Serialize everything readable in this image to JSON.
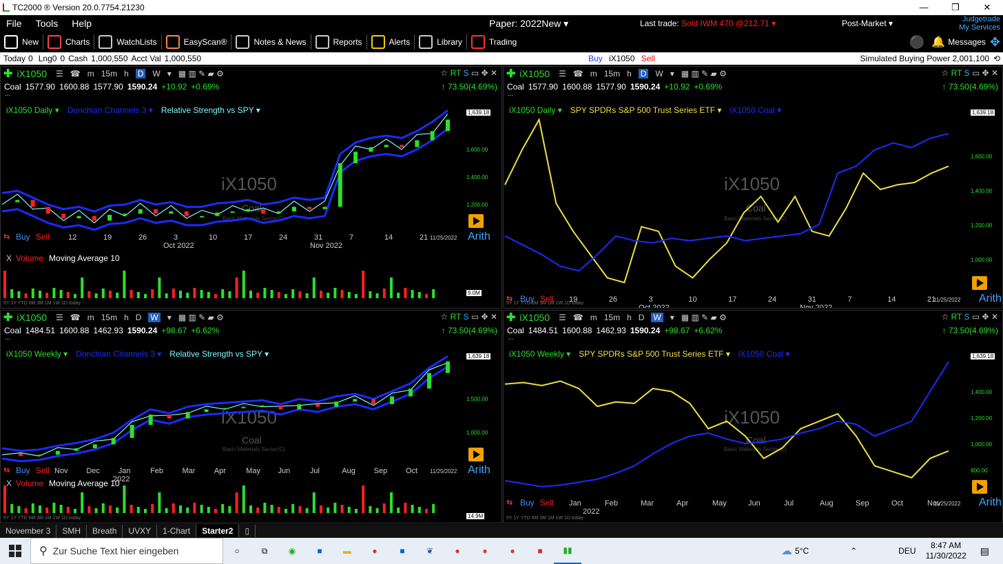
{
  "window": {
    "title": "TC2000 ® Version 20.0.7754.21230",
    "min": "—",
    "max": "❒",
    "close": "✕"
  },
  "menu": {
    "file": "File",
    "tools": "Tools",
    "help": "Help"
  },
  "header": {
    "paper": "Paper: 2022New ▾",
    "last_trade_label": "Last trade:",
    "last_trade_value": "Sold IWM 470 @212.71 ▾",
    "post_market": "Post-Market ▾",
    "judge1": "Judgetrade",
    "judge2": "My Services"
  },
  "toolbar": {
    "new": "New",
    "charts": "Charts",
    "watchlists": "WatchLists",
    "easyscan": "EasyScan®",
    "notes": "Notes & News",
    "reports": "Reports",
    "alerts": "Alerts",
    "library": "Library",
    "trading": "Trading",
    "messages": "Messages"
  },
  "account": {
    "today": "Today",
    "today_v": "0",
    "lng": "Lng",
    "lng_v": "0",
    "lng_v2": "0",
    "cash": "Cash",
    "cash_v": "1,000,550",
    "acct": "Acct Val",
    "acct_v": "1,000,550",
    "buy": "Buy",
    "sym": "iX1050",
    "sell": "Sell",
    "sbp": "Simulated Buying Power",
    "sbp_v": "2,001,100"
  },
  "panes": [
    {
      "symbol": "iX1050",
      "timeframes": [
        "m",
        "15m",
        "h",
        "D",
        "W"
      ],
      "quote": {
        "name": "Coal",
        "open": "1577.90",
        "high": "1600.88",
        "low": "1577.90",
        "last": "1590.24",
        "change": "+10.92",
        "pct": "+0.69%"
      },
      "right_change": "↑ 73.50(4.69%)",
      "legend": [
        "iX1050 Daily ▾",
        "Donchian Channels 3 ▾",
        "Relative Strength vs SPY ▾"
      ],
      "watermark": "iX1050",
      "wm_sub": "Coal",
      "wm_sector": "Basic Materials Sector(C)",
      "buy": "Buy",
      "sell": "Sell",
      "arith": "Arith",
      "date": "11/25/2022",
      "xticks": [
        "12",
        "19",
        "26",
        "3",
        "10",
        "17",
        "24",
        "31",
        "7",
        "14",
        "21"
      ],
      "months": [
        "Oct 2022",
        "Nov 2022"
      ],
      "yticks": [
        "1,639.18",
        "1,600.00",
        "1,400.00",
        "1,200.00"
      ],
      "volume": {
        "x": "X",
        "label": "Volume",
        "ma": "Moving Average 10",
        "box": "9.0M"
      },
      "scale": "5Y  1Y  YTD  6M  3M  1M  1W  1D  today"
    },
    {
      "symbol": "iX1050",
      "timeframes": [
        "m",
        "15m",
        "h",
        "D",
        "W"
      ],
      "quote": {
        "name": "Coal",
        "open": "1577.90",
        "high": "1600.88",
        "low": "1577.90",
        "last": "1590.24",
        "change": "+10.92",
        "pct": "+0.69%"
      },
      "right_change": "↑ 73.50(4.69%)",
      "legend": [
        "iX1050 Daily ▾",
        "SPY SPDRs S&P 500 Trust Series ETF ▾",
        "iX1050 Coal ▾"
      ],
      "watermark": "iX1050",
      "wm_sub": "Coal",
      "wm_sector": "Basic Materials Sector(C)",
      "buy": "Buy",
      "sell": "Sell",
      "arith": "Arith",
      "date": "11/25/2022",
      "xticks": [
        "19",
        "26",
        "3",
        "10",
        "17",
        "24",
        "31",
        "7",
        "14",
        "21"
      ],
      "months": [
        "Oct 2022",
        "Nov 2022"
      ],
      "yticks": [
        "1,639.18",
        "1,600.00",
        "1,400.00",
        "1,200.00",
        "1,000.00"
      ],
      "scale": "5Y  1Y  YTD  6M  3M  1M  1W  1D  today"
    },
    {
      "symbol": "iX1050",
      "timeframes": [
        "m",
        "15m",
        "h",
        "D",
        "W"
      ],
      "quote": {
        "name": "Coal",
        "open": "1484.51",
        "high": "1600.88",
        "low": "1462.93",
        "last": "1590.24",
        "change": "+98.67",
        "pct": "+6.62%"
      },
      "right_change": "↑ 73.50(4.69%)",
      "legend": [
        "iX1050 Weekly ▾",
        "Donchian Channels 3 ▾",
        "Relative Strength vs SPY ▾"
      ],
      "watermark": "iX1050",
      "wm_sub": "Coal",
      "wm_sector": "Basic Materials Sector(C)",
      "buy": "Buy",
      "sell": "Sell",
      "arith": "Arith",
      "date": "11/25/2022",
      "xticks": [
        "Nov",
        "Dec",
        "Jan",
        "Feb",
        "Mar",
        "Apr",
        "May",
        "Jun",
        "Jul",
        "Aug",
        "Sep",
        "Oct"
      ],
      "months": [
        "2022"
      ],
      "yticks": [
        "1,639.18",
        "1,500.00",
        "1,000.00"
      ],
      "volume": {
        "x": "X",
        "label": "Volume",
        "ma": "Moving Average 10",
        "box": "14.9M"
      },
      "scale": "5Y  1Y  YTD  6M  3M  1M  1W  1D  today"
    },
    {
      "symbol": "iX1050",
      "timeframes": [
        "m",
        "15m",
        "h",
        "D",
        "W"
      ],
      "quote": {
        "name": "Coal",
        "open": "1484.51",
        "high": "1600.88",
        "low": "1462.93",
        "last": "1590.24",
        "change": "+98.67",
        "pct": "+6.62%"
      },
      "right_change": "↑ 73.50(4.69%)",
      "legend": [
        "iX1050 Weekly ▾",
        "SPY SPDRs S&P 500 Trust Series ETF ▾",
        "iX1050 Coal ▾"
      ],
      "watermark": "iX1050",
      "wm_sub": "Coal",
      "wm_sector": "Basic Materials Sector(C)",
      "buy": "Buy",
      "sell": "Sell",
      "arith": "Arith",
      "date": "11/25/2022",
      "xticks": [
        "Jan",
        "Feb",
        "Mar",
        "Apr",
        "May",
        "Jun",
        "Jul",
        "Aug",
        "Sep",
        "Oct",
        "Nov"
      ],
      "months": [
        "2022"
      ],
      "yticks": [
        "1,639.18",
        "1,400.00",
        "1,200.00",
        "1,000.00",
        "800.00"
      ],
      "scale": "5Y  1Y  YTD  6M  3M  1M  1W  1D  today"
    }
  ],
  "tabs": [
    "November 3",
    "SMH",
    "Breath",
    "UVXY",
    "1-Chart",
    "Starter2"
  ],
  "taskbar": {
    "search": "Zur Suche Text hier eingeben",
    "weather": "5°C",
    "lang": "DEU",
    "time": "8:47 AM",
    "date": "11/30/2022"
  },
  "chart_data": [
    {
      "type": "line",
      "title": "iX1050 Daily",
      "series": [
        {
          "name": "iX1050 Coal",
          "values": [
            1230,
            1240,
            1210,
            1180,
            1160,
            1170,
            1150,
            1175,
            1180,
            1200,
            1180,
            1190,
            1170,
            1170,
            1185,
            1190,
            1200,
            1180,
            1190,
            1210,
            1200,
            1210,
            1400,
            1450,
            1470,
            1480,
            1470,
            1500,
            1540,
            1590
          ]
        }
      ]
    },
    {
      "type": "line",
      "title": "iX1050 Daily vs SPY",
      "series": [
        {
          "name": "SPY SPDRs S&P 500 Trust Series ETF",
          "values": [
            1400,
            1550,
            1680,
            1320,
            1200,
            1100,
            1000,
            980,
            1220,
            1200,
            1050,
            1000,
            1080,
            1150,
            1280,
            1350,
            1240,
            1350,
            1200,
            1180,
            1300,
            1450,
            1380,
            1400,
            1410,
            1450,
            1480
          ]
        },
        {
          "name": "iX1050 Coal",
          "values": [
            1180,
            1140,
            1100,
            1050,
            1030,
            1100,
            1180,
            1160,
            1150,
            1170,
            1160,
            1170,
            1180,
            1160,
            1170,
            1180,
            1190,
            1230,
            1450,
            1480,
            1550,
            1580,
            1560,
            1600,
            1620
          ]
        }
      ]
    },
    {
      "type": "line",
      "title": "iX1050 Weekly",
      "series": [
        {
          "name": "iX1050 Coal",
          "values": [
            880,
            860,
            870,
            900,
            920,
            950,
            1000,
            1100,
            1180,
            1150,
            1200,
            1220,
            1230,
            1240,
            1250,
            1220,
            1260,
            1240,
            1280,
            1300,
            1260,
            1320,
            1380,
            1500,
            1590
          ]
        }
      ]
    },
    {
      "type": "line",
      "title": "iX1050 Weekly vs SPY",
      "series": [
        {
          "name": "SPY SPDRs S&P 500 Trust Series ETF",
          "values": [
            1450,
            1460,
            1440,
            1470,
            1420,
            1300,
            1330,
            1320,
            1420,
            1400,
            1320,
            1150,
            1200,
            1100,
            950,
            1020,
            1150,
            1200,
            1250,
            1100,
            900,
            860,
            820,
            950,
            1000
          ]
        },
        {
          "name": "iX1050 Coal",
          "values": [
            800,
            780,
            760,
            770,
            790,
            810,
            850,
            900,
            980,
            1050,
            1100,
            1120,
            1080,
            1050,
            1060,
            1080,
            1120,
            1150,
            1200,
            1180,
            1100,
            1150,
            1200,
            1400,
            1600
          ]
        }
      ]
    }
  ]
}
